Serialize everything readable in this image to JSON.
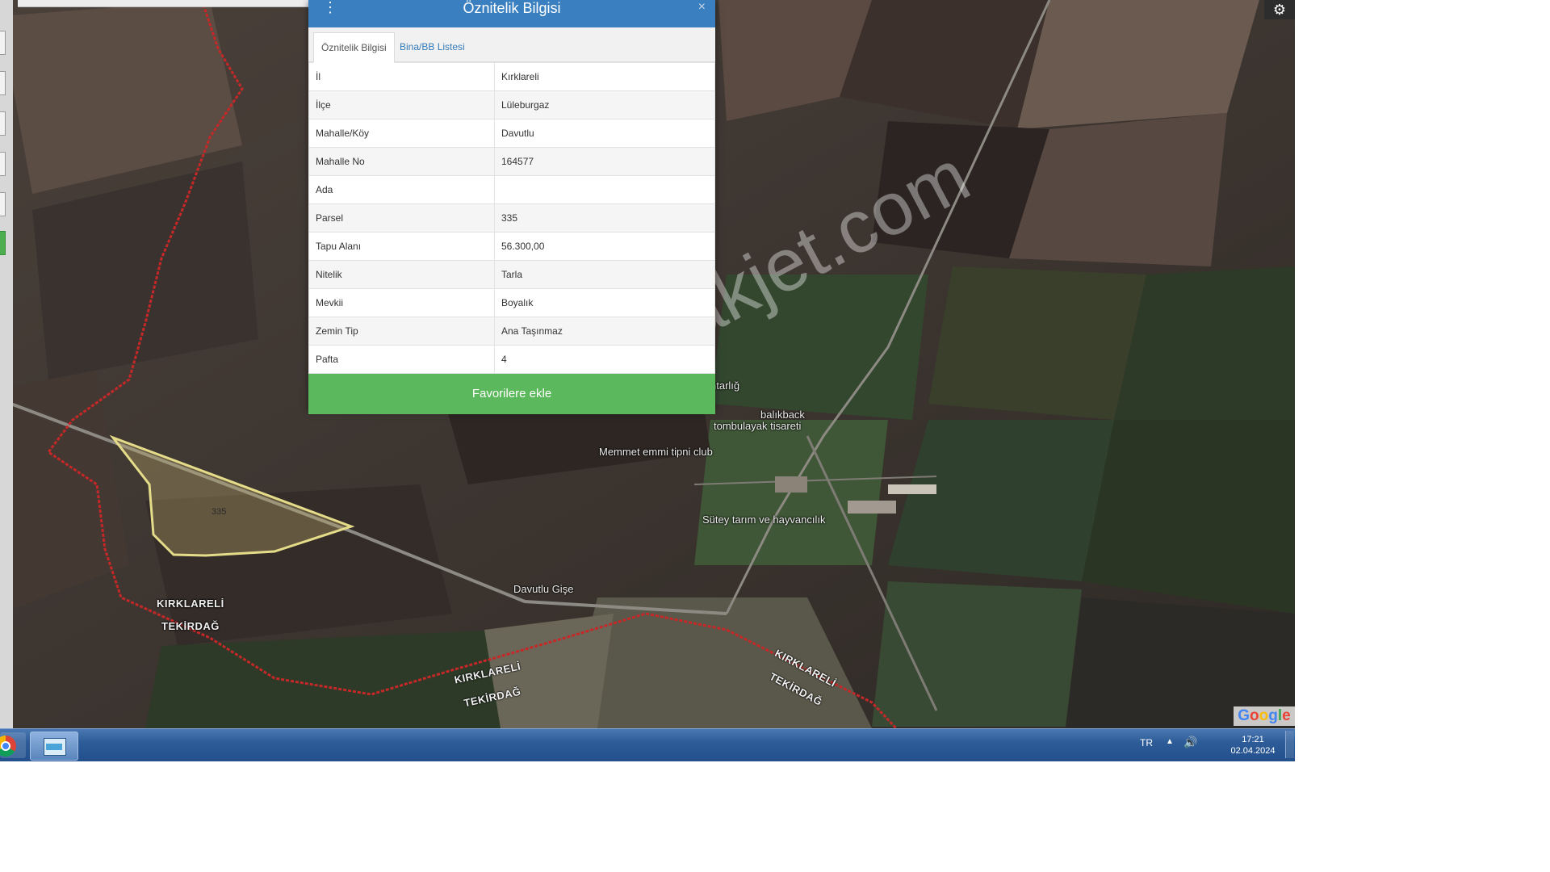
{
  "popup": {
    "title": "Öznitelik Bilgisi",
    "close": "×",
    "menu": "⋮",
    "tabs": [
      {
        "label": "Öznitelik Bilgisi",
        "active": true
      },
      {
        "label": "Bina/BB Listesi",
        "active": false
      }
    ],
    "rows": [
      {
        "key": "İl",
        "value": "Kırklareli"
      },
      {
        "key": "İlçe",
        "value": "Lüleburgaz"
      },
      {
        "key": "Mahalle/Köy",
        "value": "Davutlu"
      },
      {
        "key": "Mahalle No",
        "value": "164577"
      },
      {
        "key": "Ada",
        "value": ""
      },
      {
        "key": "Parsel",
        "value": "335"
      },
      {
        "key": "Tapu Alanı",
        "value": "56.300,00"
      },
      {
        "key": "Nitelik",
        "value": "Tarla"
      },
      {
        "key": "Mevkii",
        "value": "Boyalık"
      },
      {
        "key": "Zemin Tip",
        "value": "Ana Taşınmaz"
      },
      {
        "key": "Pafta",
        "value": "4"
      }
    ],
    "favorite_button": "Favorilere ekle",
    "colors": {
      "header": "#3a80c0",
      "favorite": "#5cb85c"
    }
  },
  "map": {
    "labels": {
      "place_1": "ntarlığ",
      "place_2": "balıkback",
      "place_3": "tombulayak tisareti",
      "place_4": "Memmet emmi tipni club",
      "place_5": "Sütey tarım ve hayvancılık",
      "place_6": "Davutlu Gişe",
      "parcel": "335",
      "region_1a": "KIRKLARELİ",
      "region_1b": "TEKİRDAĞ",
      "region_2a": "KIRKLARELİ",
      "region_2b": "TEKİRDAĞ",
      "region_3a": "KIRKLARELİ",
      "region_3b": "TEKİRDAĞ"
    },
    "watermark": "emlakjet.com",
    "attribution": [
      "G",
      "o",
      "o",
      "g",
      "l",
      "e"
    ],
    "settings_icon": "gear-icon"
  },
  "taskbar": {
    "language": "TR",
    "tray_arrow": "▲",
    "volume_icon": "🔊",
    "time": "17:21",
    "date": "02.04.2024"
  }
}
